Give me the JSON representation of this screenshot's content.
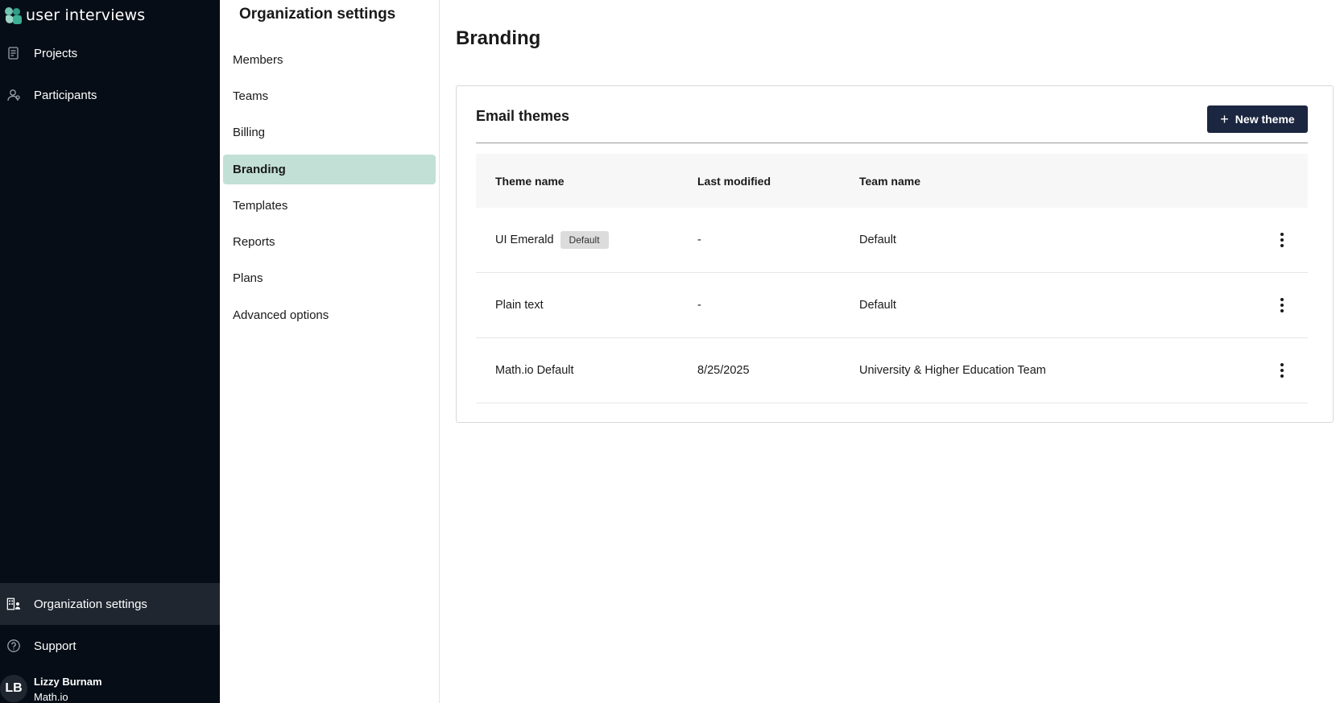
{
  "brand": {
    "name": "user interviews"
  },
  "nav": {
    "projects": "Projects",
    "participants": "Participants",
    "org_settings": "Organization settings",
    "support": "Support"
  },
  "user": {
    "initials": "LB",
    "name": "Lizzy Burnam",
    "org": "Math.io"
  },
  "settings": {
    "title": "Organization settings",
    "items": [
      {
        "label": "Members",
        "active": false
      },
      {
        "label": "Teams",
        "active": false
      },
      {
        "label": "Billing",
        "active": false
      },
      {
        "label": "Branding",
        "active": true
      },
      {
        "label": "Templates",
        "active": false
      },
      {
        "label": "Reports",
        "active": false
      },
      {
        "label": "Plans",
        "active": false
      },
      {
        "label": "Advanced options",
        "active": false
      }
    ]
  },
  "main": {
    "title": "Branding",
    "card": {
      "title": "Email themes",
      "new_button": "New theme",
      "columns": [
        "Theme name",
        "Last modified",
        "Team name"
      ],
      "rows": [
        {
          "name": "UI Emerald",
          "badge": "Default",
          "modified": "-",
          "team": "Default"
        },
        {
          "name": "Plain text",
          "badge": "",
          "modified": "-",
          "team": "Default"
        },
        {
          "name": "Math.io Default",
          "badge": "",
          "modified": "8/25/2025",
          "team": "University & Higher Education Team"
        }
      ]
    }
  },
  "colors": {
    "nav_bg": "#060d16",
    "nav_active": "#1f2630",
    "settings_active": "#c2e0d6",
    "button_bg": "#1b2640"
  },
  "icons": {
    "projects": "document-icon",
    "participants": "person-icon",
    "org_settings": "building-person-icon",
    "support": "question-circle-icon",
    "row_menu": "kebab-menu-icon",
    "add": "plus-icon"
  }
}
